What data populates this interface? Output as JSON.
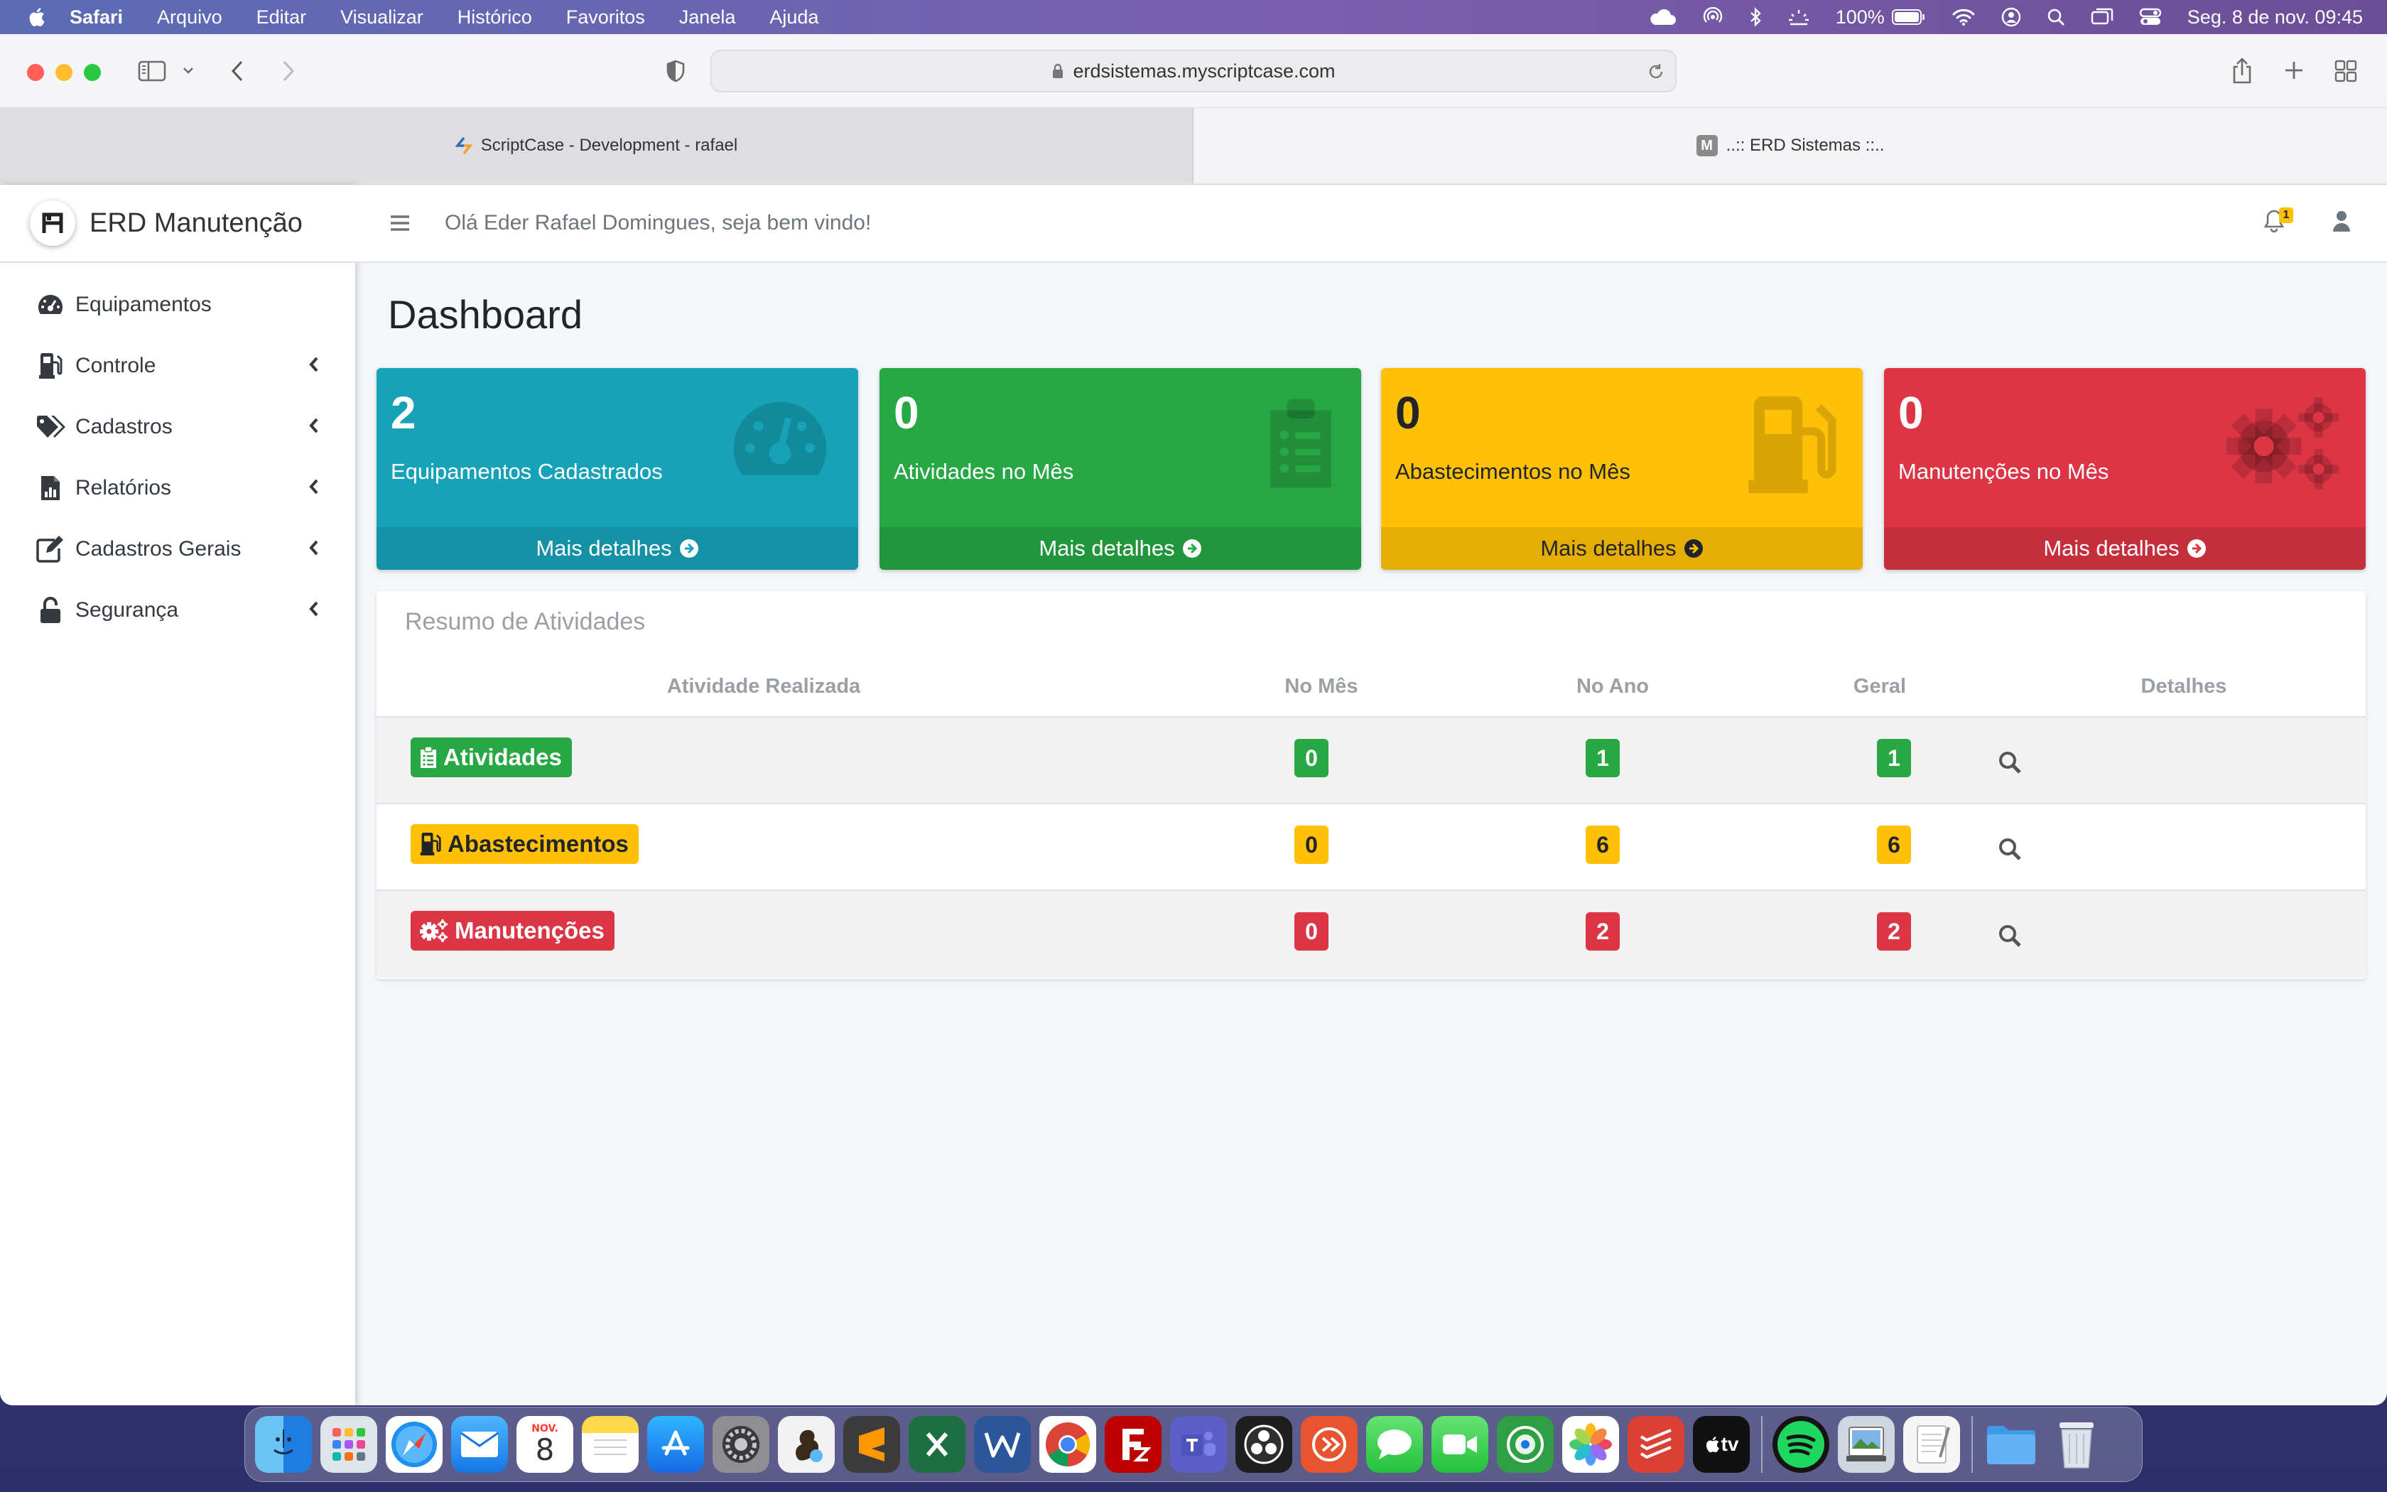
{
  "menubar": {
    "app": "Safari",
    "items": [
      "Arquivo",
      "Editar",
      "Visualizar",
      "Histórico",
      "Favoritos",
      "Janela",
      "Ajuda"
    ],
    "battery": "100%",
    "datetime": "Seg. 8 de nov.  09:45"
  },
  "browser": {
    "url": "erdsistemas.myscriptcase.com",
    "tabs": [
      {
        "label": "ScriptCase - Development - rafael"
      },
      {
        "label": "..:: ERD Sistemas ::.."
      }
    ]
  },
  "app": {
    "brand": "ERD Manutenção",
    "greeting": "Olá Eder Rafael Domingues, seja bem vindo!",
    "notification_count": "1",
    "sidebar": [
      {
        "label": "Equipamentos",
        "icon": "tachometer-icon"
      },
      {
        "label": "Controle",
        "icon": "gas-pump-icon"
      },
      {
        "label": "Cadastros",
        "icon": "tags-icon"
      },
      {
        "label": "Relatórios",
        "icon": "file-chart-icon"
      },
      {
        "label": "Cadastros Gerais",
        "icon": "edit-icon"
      },
      {
        "label": "Segurança",
        "icon": "unlock-icon"
      }
    ]
  },
  "dashboard": {
    "title": "Dashboard",
    "boxes": [
      {
        "value": "2",
        "label": "Equipamentos Cadastrados",
        "footer": "Mais detalhes",
        "color": "#17a2b8"
      },
      {
        "value": "0",
        "label": "Atividades no Mês",
        "footer": "Mais detalhes",
        "color": "#28a745"
      },
      {
        "value": "0",
        "label": "Abastecimentos no Mês",
        "footer": "Mais detalhes",
        "color": "#ffc107"
      },
      {
        "value": "0",
        "label": "Manutenções no Mês",
        "footer": "Mais detalhes",
        "color": "#dc3545"
      }
    ],
    "summary": {
      "title": "Resumo de Atividades",
      "headers": [
        "Atividade Realizada",
        "No Mês",
        "No Ano",
        "Geral",
        "Detalhes"
      ],
      "rows": [
        {
          "activity": "Atividades",
          "month": "0",
          "year": "1",
          "total": "1",
          "color": "#28a745"
        },
        {
          "activity": "Abastecimentos",
          "month": "0",
          "year": "6",
          "total": "6",
          "color": "#ffc107"
        },
        {
          "activity": "Manutenções",
          "month": "0",
          "year": "2",
          "total": "2",
          "color": "#dc3545"
        }
      ]
    }
  },
  "dock": {
    "calendar_month": "NOV.",
    "calendar_day": "8",
    "tv_label": "tv"
  }
}
